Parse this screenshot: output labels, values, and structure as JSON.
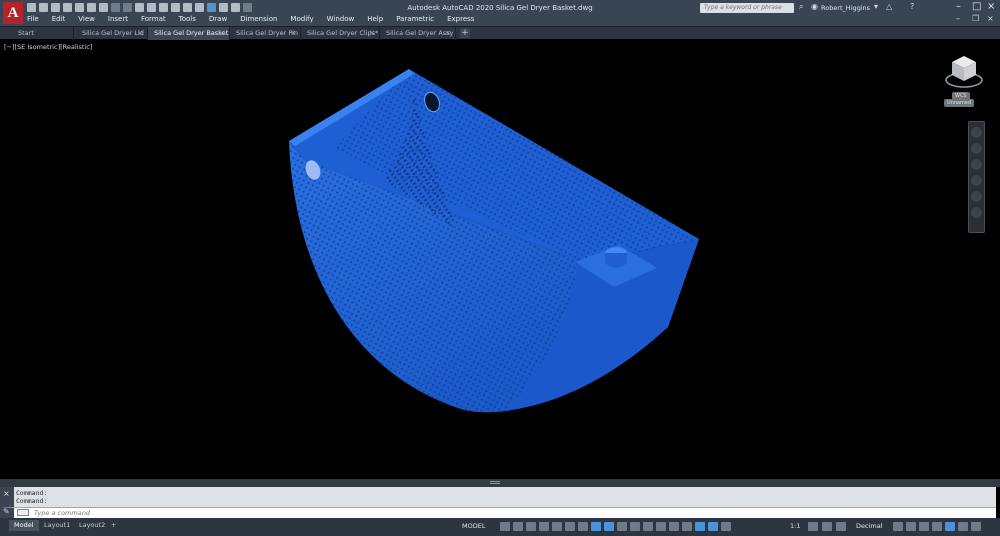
{
  "window": {
    "app_title": "Autodesk AutoCAD 2020   Silica Gel Dryer Basket.dwg",
    "app_logo": "A",
    "search_placeholder": "Type a keyword or phrase",
    "user_name": "Robert_Higgins",
    "controls": [
      "minimize-icon",
      "maximize-icon",
      "close-icon"
    ]
  },
  "menu": {
    "items": [
      "File",
      "Edit",
      "View",
      "Insert",
      "Format",
      "Tools",
      "Draw",
      "Dimension",
      "Modify",
      "Window",
      "Help",
      "Parametric",
      "Express"
    ]
  },
  "tabs": {
    "items": [
      {
        "label": "Start",
        "closable": false
      },
      {
        "label": "Silica Gel Dryer Lid",
        "closable": true
      },
      {
        "label": "Silica Gel Dryer Basket",
        "closable": true,
        "active": true
      },
      {
        "label": "Silica Gel Dryer Pin",
        "closable": true
      },
      {
        "label": "Silica Gel Dryer Clips*",
        "closable": true
      },
      {
        "label": "Silica Gel Dryer Assy",
        "closable": true
      }
    ],
    "close_glyph": "×",
    "add_glyph": "+"
  },
  "viewport": {
    "view_label": "[−][SE Isometric][Realistic]",
    "model_color": "#1e63d6",
    "viewcube_label": "WCS",
    "viewcube_sublabel": "Unnamed"
  },
  "command": {
    "history": [
      "Command:",
      "Command:"
    ],
    "placeholder": "Type a command",
    "close_glyph": "×",
    "wrench_glyph": "🔧"
  },
  "status": {
    "layout_tabs": [
      "Model",
      "Layout1",
      "Layout2"
    ],
    "add_layout": "+",
    "model_label": "MODEL",
    "scale": "1:1",
    "units": "Decimal"
  },
  "colors": {
    "title_bar": "#3a4553",
    "accent": "#4b93d8",
    "viewport_bg": "#000000"
  }
}
